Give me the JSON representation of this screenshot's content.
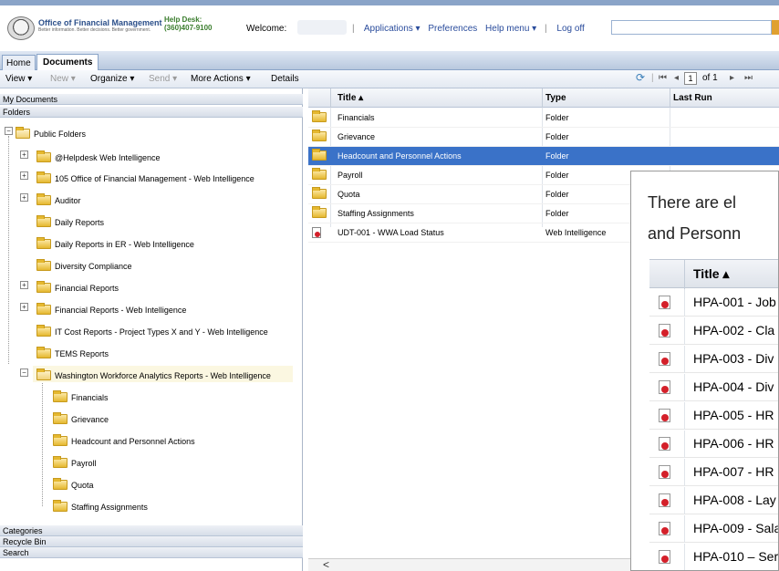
{
  "header": {
    "org_name": "Office of Financial Management",
    "org_sub": "Better information. Better decisions. Better government.",
    "helpdesk_label": "Help Desk:",
    "helpdesk_phone": "(360)407-9100",
    "welcome": "Welcome:",
    "nav": [
      "Applications ▾",
      "Preferences",
      "Help menu ▾",
      "Log off"
    ]
  },
  "tabs": [
    "Home",
    "Documents"
  ],
  "toolbar": {
    "view": "View ▾",
    "new": "New ▾",
    "organize": "Organize ▾",
    "send": "Send ▾",
    "more_actions": "More Actions ▾",
    "details": "Details",
    "page_current": "1",
    "page_total": "of 1"
  },
  "left": {
    "my_documents": "My Documents",
    "folders": "Folders",
    "tree": [
      "Public Folders",
      "@Helpdesk Web Intelligence",
      "105 Office of Financial Management - Web Intelligence",
      "Auditor",
      "Daily Reports",
      "Daily Reports in ER - Web Intelligence",
      "Diversity Compliance",
      "Financial Reports",
      "Financial Reports - Web Intelligence",
      "IT Cost Reports - Project Types X and Y - Web Intelligence",
      "TEMS Reports",
      "Washington Workforce Analytics Reports - Web Intelligence",
      "Financials",
      "Grievance",
      "Headcount and Personnel Actions",
      "Payroll",
      "Quota",
      "Staffing Assignments"
    ],
    "bottom": [
      "Categories",
      "Recycle Bin",
      "Search"
    ]
  },
  "grid": {
    "columns": [
      "Title ▴",
      "Type",
      "Last Run"
    ],
    "rows": [
      {
        "title": "Financials",
        "type": "Folder",
        "icon": "folder-icon"
      },
      {
        "title": "Grievance",
        "type": "Folder",
        "icon": "folder-icon"
      },
      {
        "title": "Headcount and Personnel Actions",
        "type": "Folder",
        "icon": "folder-icon"
      },
      {
        "title": "Payroll",
        "type": "Folder",
        "icon": "folder-icon"
      },
      {
        "title": "Quota",
        "type": "Folder",
        "icon": "folder-icon"
      },
      {
        "title": "Staffing Assignments",
        "type": "Folder",
        "icon": "folder-icon"
      },
      {
        "title": "UDT-001 - WWA Load Status",
        "type": "Web Intelligence",
        "icon": "webi-doc-icon"
      }
    ],
    "scroll_left": "<"
  },
  "overlay": {
    "line1": "There are el",
    "line2": "and Personn",
    "header": "Title ▴",
    "rows": [
      "HPA-001 - Job",
      "HPA-002 - Cla",
      "HPA-003 - Div",
      "HPA-004 - Div",
      "HPA-005 - HR",
      "HPA-006 - HR",
      "HPA-007 - HR",
      "HPA-008 - Lay",
      "HPA-009 - Sala",
      "HPA-010 – Ser"
    ]
  },
  "colors": {
    "accent": "#3a72c8",
    "header_blue": "#2b4f8a",
    "helpdesk_green": "#3a7d2d"
  }
}
